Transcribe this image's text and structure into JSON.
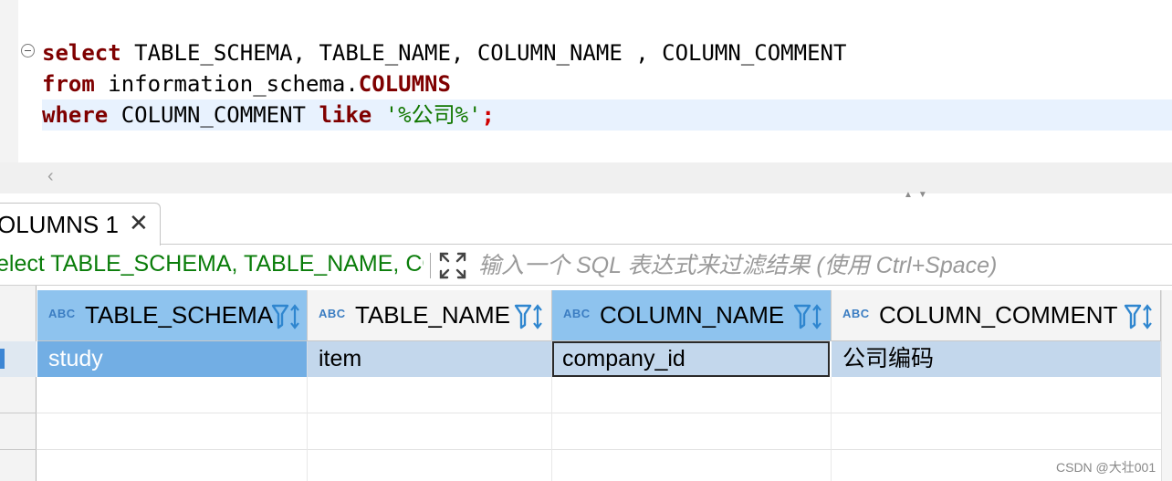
{
  "editor": {
    "line1": {
      "kw": "select",
      "rest": " TABLE_SCHEMA, TABLE_NAME, COLUMN_NAME , COLUMN_COMMENT"
    },
    "line2": {
      "kw": "from",
      "mid": " information_schema.",
      "obj": "COLUMNS"
    },
    "line3": {
      "kw": "where",
      "mid": " COLUMN_COMMENT ",
      "kw2": "like",
      "sp": " ",
      "str": "'%公司%'",
      "semi": ";"
    },
    "scroll_left_glyph": "‹",
    "panel_arrows": "▲▼"
  },
  "result_tab": {
    "label": "OLUMNS 1",
    "close_glyph": "✕"
  },
  "filter": {
    "query_text": "elect TABLE_SCHEMA, TABLE_NAME, COLUMN_NAME, COLUMN_COMMENT",
    "placeholder": "输入一个 SQL 表达式来过滤结果 (使用 Ctrl+Space)",
    "expand_icon": "expand-icon"
  },
  "grid": {
    "type_badge": "ABC",
    "columns": [
      {
        "name": "TABLE_SCHEMA",
        "selected": true
      },
      {
        "name": "TABLE_NAME",
        "selected": false
      },
      {
        "name": "COLUMN_NAME",
        "selected": true
      },
      {
        "name": "COLUMN_COMMENT",
        "selected": false
      }
    ],
    "rows": [
      [
        "study",
        "item",
        "company_id",
        "公司编码"
      ]
    ]
  },
  "colors": {
    "keyword": "#7f0000",
    "string": "#117700",
    "selected_header": "#8ec3ee",
    "selected_cell": "#72aee4",
    "row_highlight": "#c3d7ec"
  },
  "watermark": "CSDN @大壮001"
}
